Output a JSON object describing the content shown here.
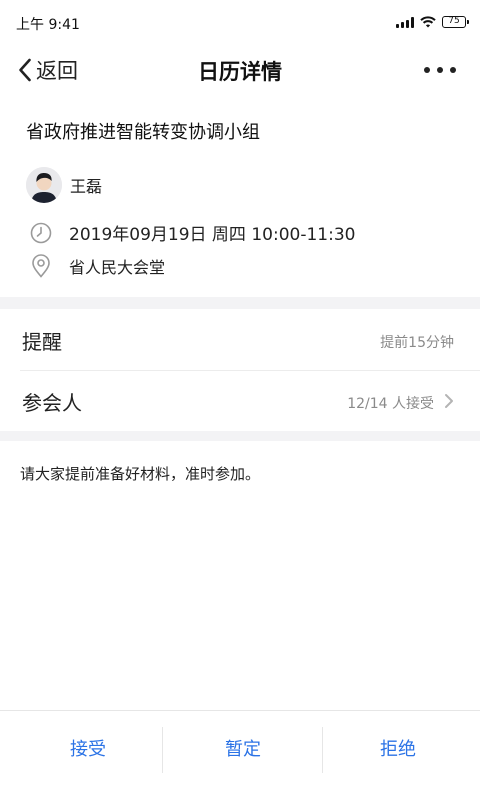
{
  "status": {
    "time": "上午 9:41",
    "battery": "75",
    "icons": [
      "signal-icon",
      "wifi-icon",
      "battery-icon"
    ]
  },
  "nav": {
    "back_label": "返回",
    "title": "日历详情",
    "back_icon": "chevron-left-icon",
    "more_icon": "more-icon"
  },
  "event": {
    "title": "省政府推进智能转变协调小组",
    "organizer": "王磊",
    "datetime": "2019年09月19日 周四 10:00-11:30",
    "location": "省人民大会堂",
    "note": "请大家提前准备好材料，准时参加。"
  },
  "settings": {
    "reminder_label": "提醒",
    "reminder_value": "提前15分钟",
    "attendees_label": "参会人",
    "attendees_value": "12/14 人接受"
  },
  "actions": {
    "accept": "接受",
    "tentative": "暂定",
    "decline": "拒绝"
  },
  "colors": {
    "accent": "#2b73e6",
    "section_bg": "#f3f3f5",
    "secondary_text": "#8a8a8a"
  }
}
